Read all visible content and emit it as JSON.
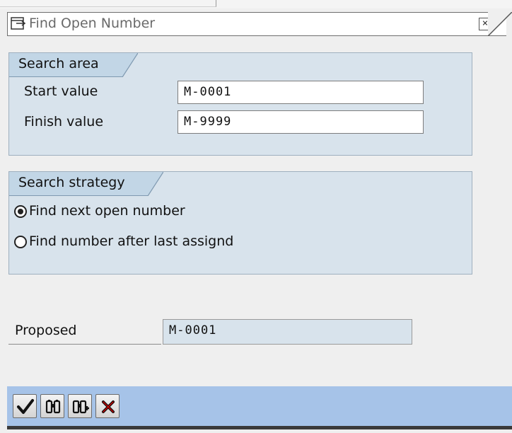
{
  "window": {
    "title": "Find Open Number",
    "close_glyph": "×"
  },
  "search_area": {
    "heading": "Search area",
    "start_label": "Start value",
    "start_value": "M-0001",
    "finish_label": "Finish value",
    "finish_value": "M-9999"
  },
  "search_strategy": {
    "heading": "Search strategy",
    "options": [
      {
        "label": "Find next open number",
        "selected": true
      },
      {
        "label": "Find number after last assignd",
        "selected": false
      }
    ]
  },
  "result": {
    "proposed_label": "Proposed",
    "proposed_value": "M-0001"
  },
  "toolbar": {
    "buttons": [
      {
        "icon": "checkmark-icon",
        "action": "confirm"
      },
      {
        "icon": "binoculars-icon",
        "action": "find"
      },
      {
        "icon": "binoculars-plus-icon",
        "action": "find-next"
      },
      {
        "icon": "cancel-x-icon",
        "action": "cancel"
      }
    ]
  },
  "colors": {
    "group_background": "#d8e3ec",
    "group_tab": "#c2d6e6",
    "toolbar_background": "#a6c3e8",
    "title_text": "#6a6a6a"
  }
}
